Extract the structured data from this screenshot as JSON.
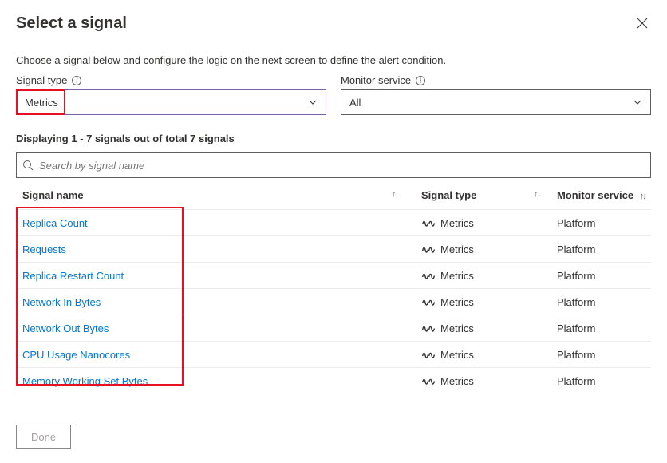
{
  "header": {
    "title": "Select a signal",
    "close_aria": "Close"
  },
  "subtitle": "Choose a signal below and configure the logic on the next screen to define the alert condition.",
  "filters": {
    "signal_type": {
      "label": "Signal type",
      "value": "Metrics"
    },
    "monitor_service": {
      "label": "Monitor service",
      "value": "All"
    }
  },
  "displaying": "Displaying 1 - 7 signals out of total 7 signals",
  "search": {
    "placeholder": "Search by signal name"
  },
  "columns": {
    "name": "Signal name",
    "type": "Signal type",
    "service": "Monitor service"
  },
  "signals": [
    {
      "name": "Replica Count",
      "type": "Metrics",
      "service": "Platform"
    },
    {
      "name": "Requests",
      "type": "Metrics",
      "service": "Platform"
    },
    {
      "name": "Replica Restart Count",
      "type": "Metrics",
      "service": "Platform"
    },
    {
      "name": "Network In Bytes",
      "type": "Metrics",
      "service": "Platform"
    },
    {
      "name": "Network Out Bytes",
      "type": "Metrics",
      "service": "Platform"
    },
    {
      "name": "CPU Usage Nanocores",
      "type": "Metrics",
      "service": "Platform"
    },
    {
      "name": "Memory Working Set Bytes",
      "type": "Metrics",
      "service": "Platform"
    }
  ],
  "footer": {
    "done": "Done"
  },
  "icons": {
    "metric_glyph": "∿∿"
  }
}
